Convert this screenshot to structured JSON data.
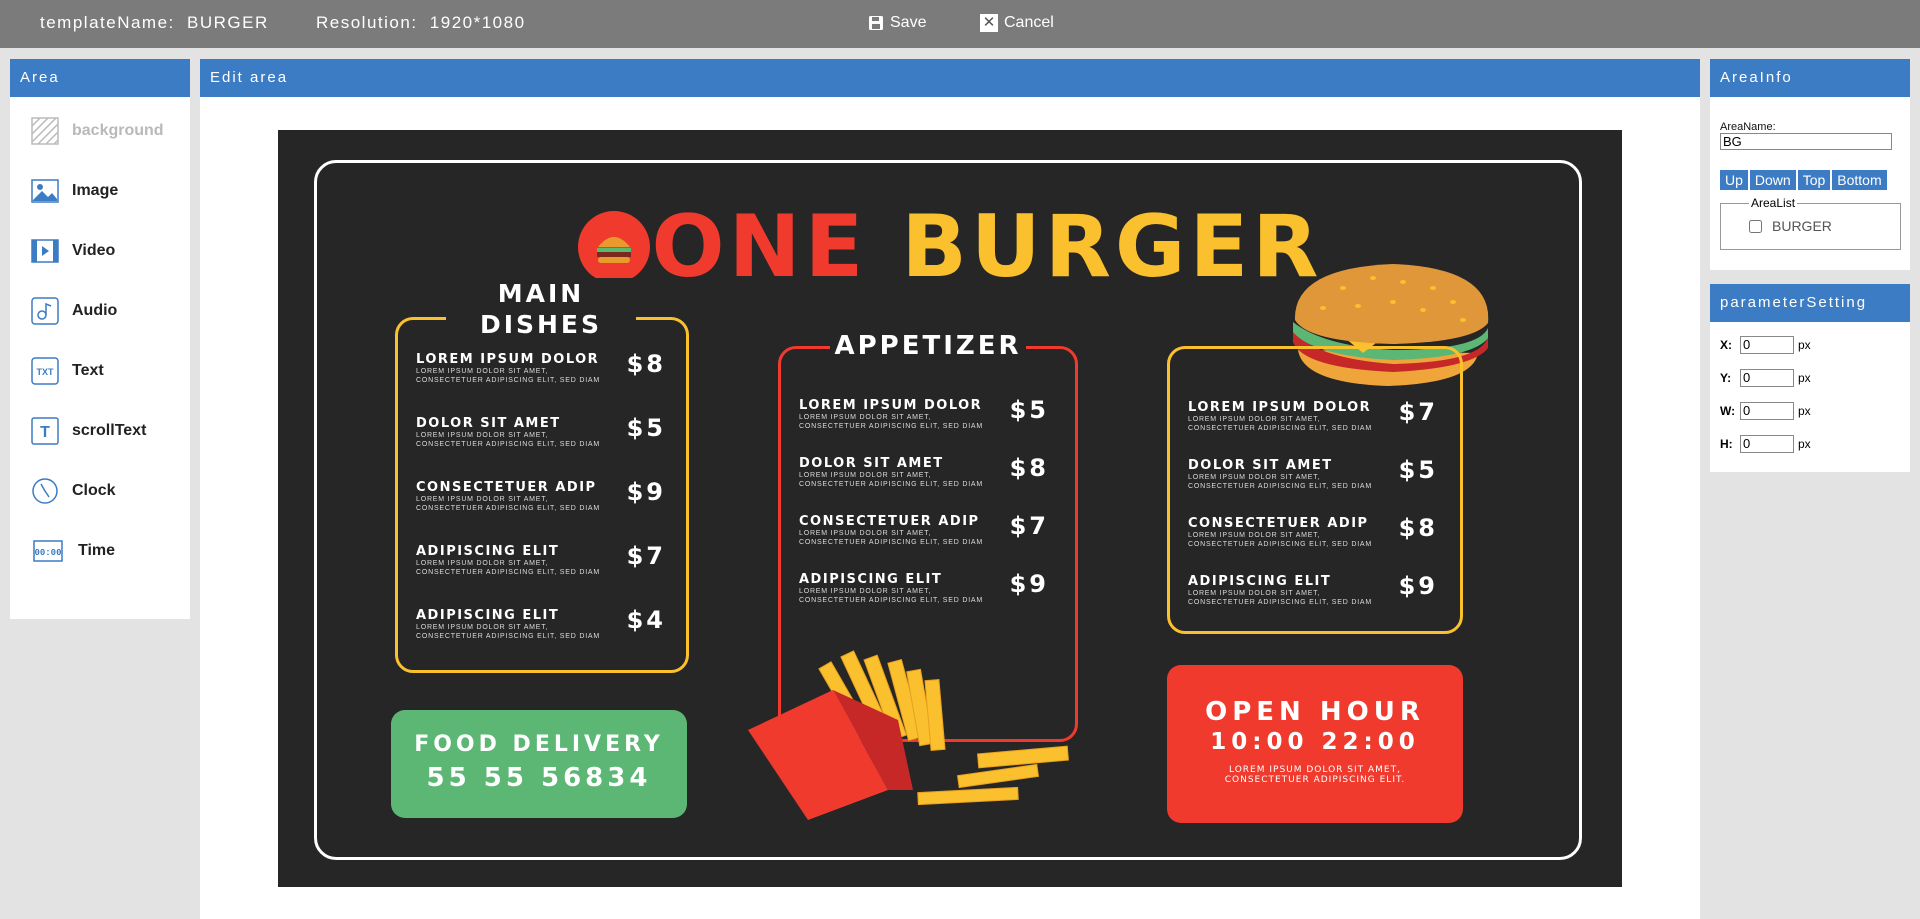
{
  "topbar": {
    "template_name_label": "templateName:",
    "template_name_value": "BURGER",
    "resolution_label": "Resolution:",
    "resolution_value": "1920*1080",
    "save_label": "Save",
    "cancel_label": "Cancel"
  },
  "area_panel": {
    "title": "Area",
    "tools": [
      {
        "label": "background",
        "icon": "background-icon",
        "enabled": false
      },
      {
        "label": "Image",
        "icon": "image-icon",
        "enabled": true
      },
      {
        "label": "Video",
        "icon": "video-icon",
        "enabled": true
      },
      {
        "label": "Audio",
        "icon": "audio-icon",
        "enabled": true
      },
      {
        "label": "Text",
        "icon": "text-icon",
        "icon_text": "TXT",
        "enabled": true
      },
      {
        "label": "scrollText",
        "icon": "scroll-text-icon",
        "icon_text": "T",
        "enabled": true
      },
      {
        "label": "Clock",
        "icon": "clock-icon",
        "enabled": true
      },
      {
        "label": "Time",
        "icon": "time-icon",
        "icon_text": "00:00",
        "enabled": true
      }
    ]
  },
  "edit_panel": {
    "title": "Edit area"
  },
  "menu": {
    "title_one": "ONE",
    "title_burger": "BURGER",
    "main_dishes": {
      "title_line1": "MAIN",
      "title_line2": "DISHES",
      "items": [
        {
          "name": "LOREM IPSUM DOLOR",
          "desc1": "LOREM IPSUM DOLOR SIT AMET,",
          "desc2": "CONSECTETUER ADIPISCING ELIT, SED DIAM",
          "price": "$8"
        },
        {
          "name": "DOLOR SIT AMET",
          "desc1": "LOREM IPSUM DOLOR SIT AMET,",
          "desc2": "CONSECTETUER ADIPISCING ELIT, SED DIAM",
          "price": "$5"
        },
        {
          "name": "CONSECTETUER ADIP",
          "desc1": "LOREM IPSUM DOLOR SIT AMET,",
          "desc2": "CONSECTETUER ADIPISCING ELIT, SED DIAM",
          "price": "$9"
        },
        {
          "name": "ADIPISCING ELIT",
          "desc1": "LOREM IPSUM DOLOR SIT AMET,",
          "desc2": "CONSECTETUER ADIPISCING ELIT, SED DIAM",
          "price": "$7"
        },
        {
          "name": "ADIPISCING ELIT",
          "desc1": "LOREM IPSUM DOLOR SIT AMET,",
          "desc2": "CONSECTETUER ADIPISCING ELIT, SED DIAM",
          "price": "$4"
        }
      ]
    },
    "appetizer": {
      "title": "APPETIZER",
      "items": [
        {
          "name": "LOREM IPSUM DOLOR",
          "desc1": "LOREM IPSUM DOLOR SIT AMET,",
          "desc2": "CONSECTETUER ADIPISCING ELIT, SED DIAM",
          "price": "$5"
        },
        {
          "name": "DOLOR SIT AMET",
          "desc1": "LOREM IPSUM DOLOR SIT AMET,",
          "desc2": "CONSECTETUER ADIPISCING ELIT, SED DIAM",
          "price": "$8"
        },
        {
          "name": "CONSECTETUER ADIP",
          "desc1": "LOREM IPSUM DOLOR SIT AMET,",
          "desc2": "CONSECTETUER ADIPISCING ELIT, SED DIAM",
          "price": "$7"
        },
        {
          "name": "ADIPISCING ELIT",
          "desc1": "LOREM IPSUM DOLOR SIT AMET,",
          "desc2": "CONSECTETUER ADIPISCING ELIT, SED DIAM",
          "price": "$9"
        }
      ]
    },
    "burgers": {
      "items": [
        {
          "name": "LOREM IPSUM DOLOR",
          "desc1": "LOREM IPSUM DOLOR SIT AMET,",
          "desc2": "CONSECTETUER ADIPISCING ELIT, SED DIAM",
          "price": "$7"
        },
        {
          "name": "DOLOR SIT AMET",
          "desc1": "LOREM IPSUM DOLOR SIT AMET,",
          "desc2": "CONSECTETUER ADIPISCING ELIT, SED DIAM",
          "price": "$5"
        },
        {
          "name": "CONSECTETUER ADIP",
          "desc1": "LOREM IPSUM DOLOR SIT AMET,",
          "desc2": "CONSECTETUER ADIPISCING ELIT, SED DIAM",
          "price": "$8"
        },
        {
          "name": "ADIPISCING ELIT",
          "desc1": "LOREM IPSUM DOLOR SIT AMET,",
          "desc2": "CONSECTETUER ADIPISCING ELIT, SED DIAM",
          "price": "$9"
        }
      ]
    },
    "delivery": {
      "label": "FOOD DELIVERY",
      "phone": "55 55 56834"
    },
    "open_hour": {
      "label": "OPEN HOUR",
      "hours": "10:00 22:00",
      "desc1": "LOREM IPSUM DOLOR SIT AMET,",
      "desc2": "CONSECTETUER ADIPISCING ELIT."
    }
  },
  "areainfo_panel": {
    "title": "AreaInfo",
    "area_name_label": "AreaName:",
    "area_name_value": "BG",
    "buttons": [
      "Up",
      "Down",
      "Top",
      "Bottom"
    ],
    "area_list_label": "AreaList",
    "area_list_items": [
      {
        "label": "BURGER",
        "checked": false
      }
    ]
  },
  "param_panel": {
    "title": "parameterSetting",
    "unit": "px",
    "fields": [
      {
        "label": "X:",
        "value": "0"
      },
      {
        "label": "Y:",
        "value": "0"
      },
      {
        "label": "W:",
        "value": "0"
      },
      {
        "label": "H:",
        "value": "0"
      }
    ]
  },
  "colors": {
    "accent_blue": "#3c7cc4",
    "topbar_gray": "#7b7b7b",
    "menu_bg": "#262626",
    "red": "#f03a2e",
    "yellow": "#fbc02d",
    "green": "#5cb775"
  }
}
